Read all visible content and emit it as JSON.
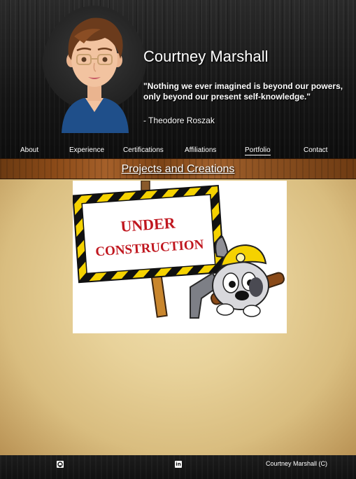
{
  "profile": {
    "name": "Courtney Marshall",
    "quote": "\"Nothing we ever imagined is beyond our powers, only beyond our present self-knowledge.\"",
    "author": "- Theodore Roszak"
  },
  "nav": {
    "items": [
      {
        "label": "About"
      },
      {
        "label": "Experience"
      },
      {
        "label": "Certifications"
      },
      {
        "label": "Affiliations"
      },
      {
        "label": "Portfolio",
        "active": true
      },
      {
        "label": "Contact"
      }
    ]
  },
  "section": {
    "title": "Projects and Creations"
  },
  "construction": {
    "line1": "UNDER",
    "line2": "CONSTRUCTION"
  },
  "footer": {
    "github_icon": "github-icon",
    "linkedin_icon": "linkedin-icon",
    "linkedin_glyph": "in",
    "copyright": "Courtney Marshall (C)"
  },
  "colors": {
    "construction_red": "#c0171f",
    "stripe_yellow": "#f5d200",
    "section_wood": "#8a4a18",
    "parchment": "#e8d29a"
  }
}
